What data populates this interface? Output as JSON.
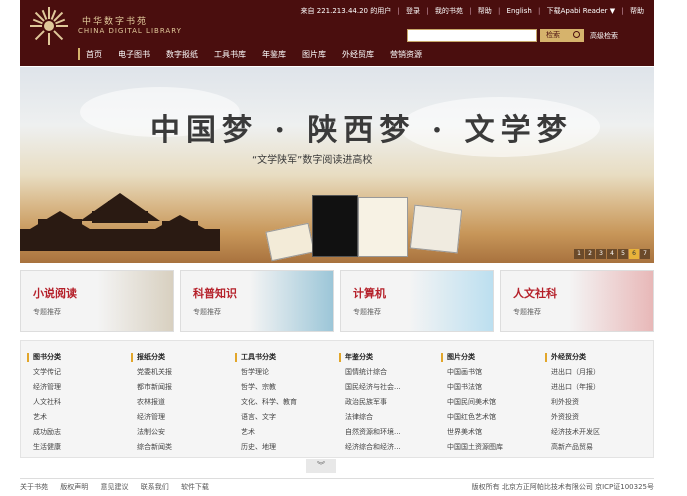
{
  "header": {
    "logo_cn": "中华数字书苑",
    "logo_en": "CHINA DIGITAL LIBRARY",
    "user_info": "来自 221.213.44.20 的用户",
    "links": [
      "登录",
      "我的书苑",
      "帮助",
      "English",
      "下载Apabi Reader ▼",
      "帮助"
    ],
    "search_button": "检索",
    "advanced_search": "高级检索"
  },
  "nav": {
    "items": [
      "首页",
      "电子图书",
      "数字报纸",
      "工具书库",
      "年鉴库",
      "图片库",
      "外经贸库",
      "营销资源"
    ]
  },
  "banner": {
    "title": "中国梦 · 陕西梦 · 文学梦",
    "subtitle": "“文学陕军”数字阅读进高校",
    "pages": [
      "1",
      "2",
      "3",
      "4",
      "5",
      "6",
      "7"
    ],
    "active_page": "6"
  },
  "tiles": [
    {
      "title": "小说阅读",
      "sub": "专题推荐"
    },
    {
      "title": "科普知识",
      "sub": "专题推荐"
    },
    {
      "title": "计算机",
      "sub": "专题推荐"
    },
    {
      "title": "人文社科",
      "sub": "专题推荐"
    }
  ],
  "categories": [
    {
      "head": "图书分类",
      "items": [
        "文学传记",
        "经济管理",
        "人文社科",
        "艺术",
        "成功励志",
        "生活健康"
      ]
    },
    {
      "head": "报纸分类",
      "items": [
        "党委机关报",
        "都市新闻报",
        "农林报道",
        "经济管理",
        "法制公安",
        "综合新闻类"
      ]
    },
    {
      "head": "工具书分类",
      "items": [
        "哲学理论",
        "哲学、宗教",
        "文化、科学、教育",
        "语言、文字",
        "艺术",
        "历史、地理"
      ]
    },
    {
      "head": "年鉴分类",
      "items": [
        "国情统计综合",
        "国民经济与社会...",
        "政治民族军事",
        "法律综合",
        "自然资源和环境...",
        "经济综合和经济..."
      ]
    },
    {
      "head": "图片分类",
      "items": [
        "中国画书馆",
        "中国书法馆",
        "中国民间美术馆",
        "中国红色艺术馆",
        "世界美术馆",
        "中国国土资源图库"
      ]
    },
    {
      "head": "外经贸分类",
      "items": [
        "进出口（月报）",
        "进出口（年报）",
        "利外投资",
        "外资投资",
        "经济技术开发区",
        "高新产品贸易"
      ]
    }
  ],
  "expand_label": "︾",
  "footer": {
    "links": [
      "关于书苑",
      "版权声明",
      "意见建议",
      "联系我们",
      "软件下载"
    ],
    "copyright": "版权所有  北京方正阿帕比技术有限公司  京ICP证100325号"
  }
}
